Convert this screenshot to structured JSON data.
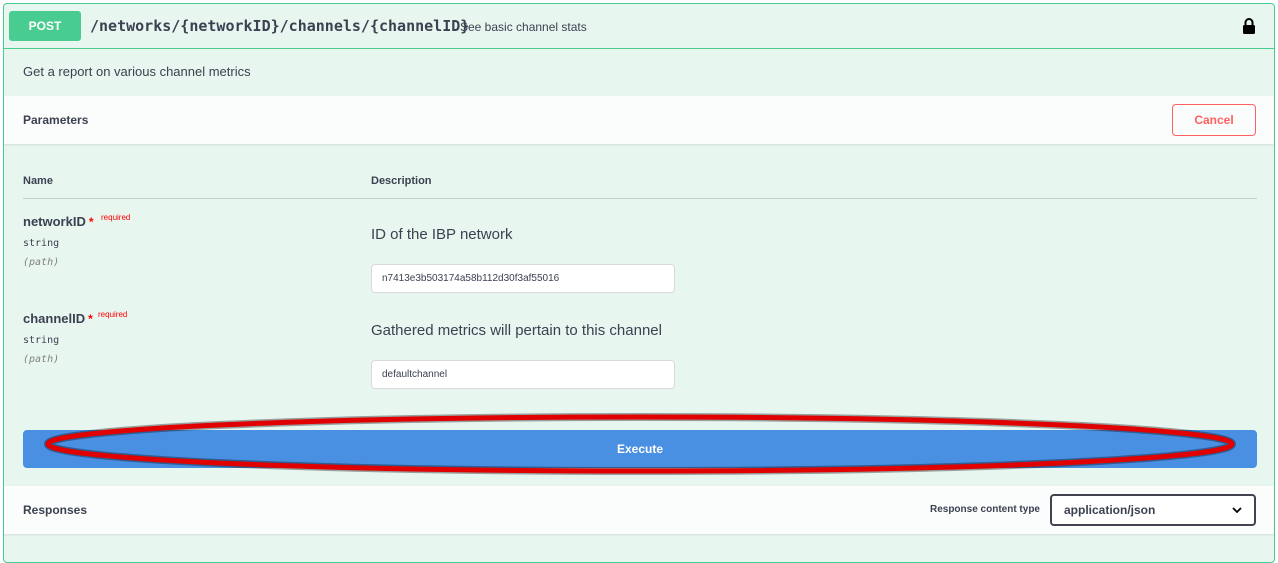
{
  "operation": {
    "method": "POST",
    "path": "/networks/{networkID}/channels/{channelID}",
    "summary": "See basic channel stats",
    "description": "Get a report on various channel metrics",
    "lock_icon": "lock-icon"
  },
  "parameters": {
    "title": "Parameters",
    "cancel_label": "Cancel",
    "col_name": "Name",
    "col_description": "Description",
    "items": [
      {
        "name": "networkID",
        "star": "*",
        "required": "required",
        "type": "string",
        "in": "(path)",
        "description": "ID of the IBP network",
        "value": "n7413e3b503174a58b112d30f3af55016"
      },
      {
        "name": "channelID",
        "star": "*",
        "required": "required",
        "type": "string",
        "in": "(path)",
        "description": "Gathered metrics will pertain to this channel",
        "value": "defaultchannel"
      }
    ]
  },
  "execute_label": "Execute",
  "responses": {
    "title": "Responses",
    "content_type_label": "Response content type",
    "content_type_value": "application/json"
  },
  "colors": {
    "post_green": "#49cc90",
    "block_bg": "#e8f6f0",
    "execute_blue": "#4990e2",
    "cancel_red": "#ff6060",
    "annotation_red": "#e00000"
  }
}
